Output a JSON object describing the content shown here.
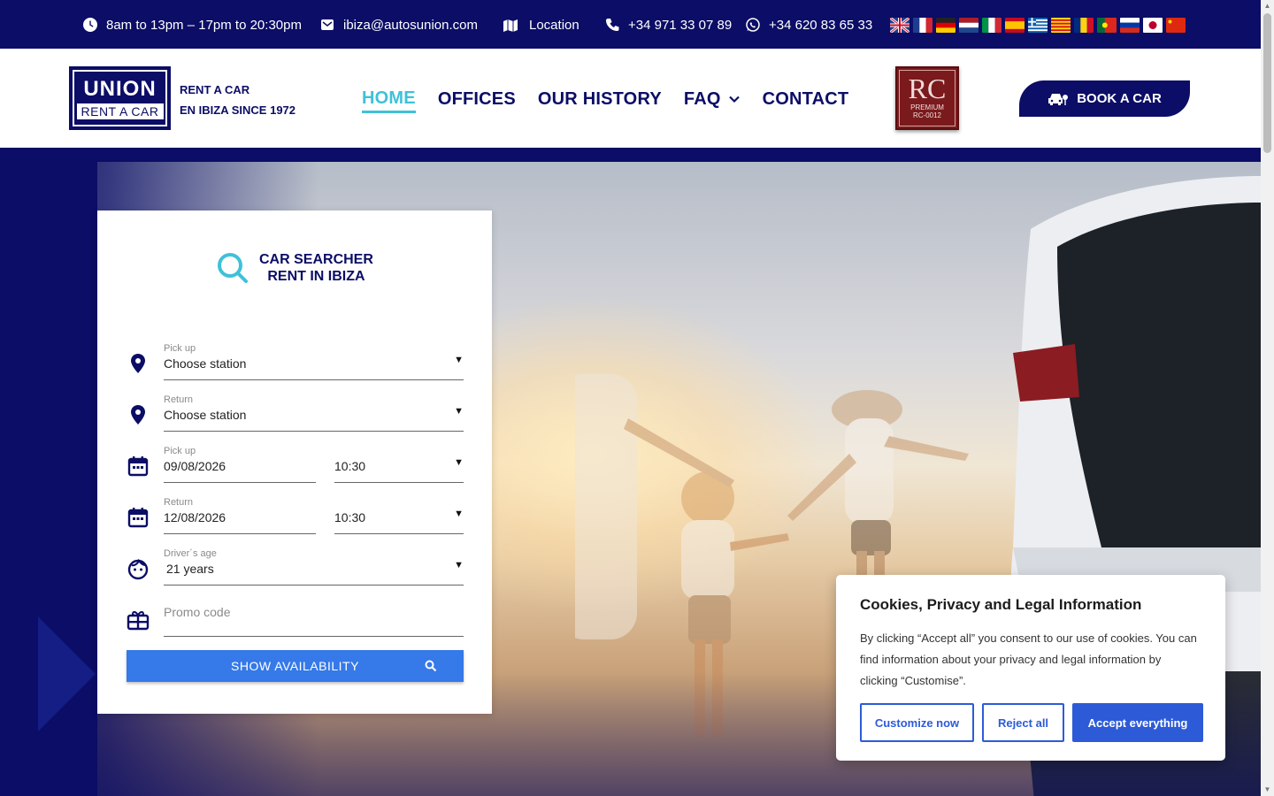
{
  "topbar": {
    "hours": "8am to 13pm – 17pm to 20:30pm",
    "email": "ibiza@autosunion.com",
    "location": "Location",
    "phone": "+34 971 33 07 89",
    "whatsapp": "+34 620 83 65 33",
    "languages": [
      "english-flag",
      "french-flag",
      "german-flag",
      "dutch-flag",
      "italian-flag",
      "spanish-flag",
      "greek-flag",
      "catalan-flag",
      "romanian-flag",
      "portuguese-flag",
      "russian-flag",
      "japanese-flag",
      "chinese-flag"
    ]
  },
  "header": {
    "logo_top": "UNION",
    "logo_bottom": "RENT A CAR",
    "tagline_1": "RENT A CAR",
    "tagline_2": "EN IBIZA SINCE 1972",
    "nav": [
      "HOME",
      "OFFICES",
      "OUR HISTORY",
      "FAQ",
      "CONTACT"
    ],
    "badge_big": "RC",
    "badge_line1": "PREMIUM",
    "badge_line2": "RC-0012",
    "book_label": "BOOK A CAR"
  },
  "search": {
    "title_1": "CAR SEARCHER",
    "title_2": "RENT IN IBIZA",
    "pickup_label": "Pick up",
    "pickup_value": "Choose station",
    "return_label": "Return",
    "return_value": "Choose station",
    "pickup_date_label": "Pick up",
    "pickup_date": "09/08/2026",
    "pickup_time": "10:30",
    "return_date_label": "Return",
    "return_date": "12/08/2026",
    "return_time": "10:30",
    "age_label": "Driver´s age",
    "age_value": "21 years",
    "promo_placeholder": "Promo code",
    "button": "SHOW AVAILABILITY"
  },
  "cookie": {
    "title": "Cookies, Privacy and Legal Information",
    "text": "By clicking “Accept all” you consent to our use of cookies. You can find information about your privacy and legal information by clicking “Customise”.",
    "customize": "Customize now",
    "reject": "Reject all",
    "accept": "Accept everything"
  },
  "colors": {
    "brand_navy": "#0b0d66",
    "accent_cyan": "#3fc1d9",
    "button_blue": "#3679e8",
    "cookie_blue": "#2d5bd8"
  }
}
